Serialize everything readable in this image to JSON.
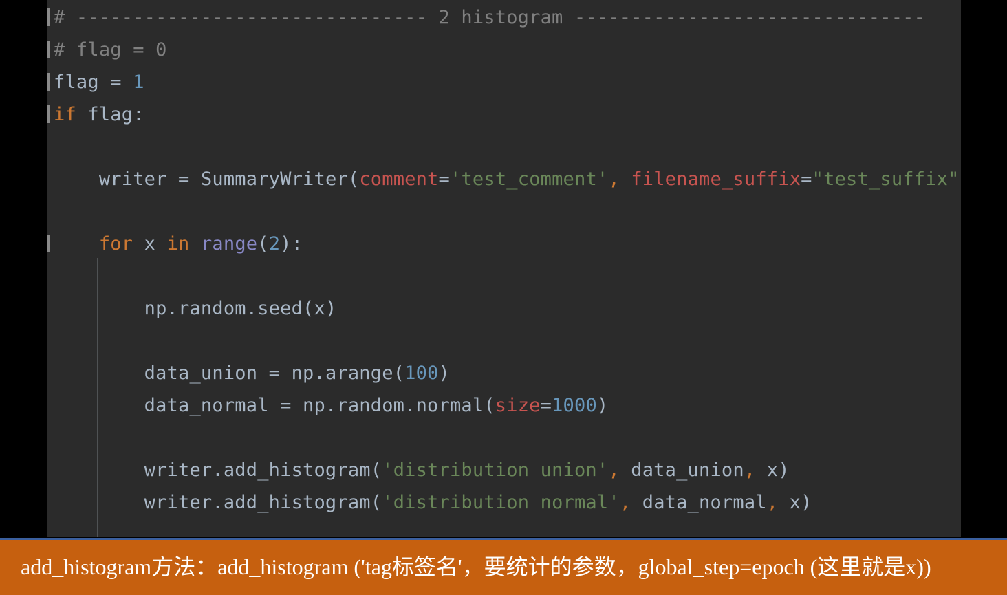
{
  "editor": {
    "background_color": "#2b2b2b",
    "side_band_color": "#000000",
    "lines": [
      {
        "id": "comment-section-header",
        "tokens": [
          {
            "cls": "t-comment",
            "text": "# ------------------------------- 2 histogram -------------------------------"
          }
        ]
      },
      {
        "id": "commented-flag-zero",
        "tokens": [
          {
            "cls": "t-comment",
            "text": "# flag = 0"
          }
        ]
      },
      {
        "id": "flag-assign",
        "tokens": [
          {
            "cls": "t-plain",
            "text": "flag "
          },
          {
            "cls": "t-op",
            "text": "= "
          },
          {
            "cls": "t-num",
            "text": "1"
          }
        ]
      },
      {
        "id": "if-flag",
        "tokens": [
          {
            "cls": "t-keyword",
            "text": "if "
          },
          {
            "cls": "t-plain",
            "text": "flag:"
          }
        ]
      },
      {
        "id": "blank-1",
        "tokens": [
          {
            "cls": "t-plain",
            "text": ""
          }
        ]
      },
      {
        "id": "summarywriter-assign",
        "tokens": [
          {
            "cls": "t-plain",
            "text": "    writer "
          },
          {
            "cls": "t-op",
            "text": "= "
          },
          {
            "cls": "t-plain",
            "text": "SummaryWriter"
          },
          {
            "cls": "t-paren",
            "text": "("
          },
          {
            "cls": "t-kwarg2",
            "text": "comment"
          },
          {
            "cls": "t-op",
            "text": "="
          },
          {
            "cls": "t-str",
            "text": "'test_comment'"
          },
          {
            "cls": "t-comma",
            "text": ", "
          },
          {
            "cls": "t-kwarg2",
            "text": "filename_suffix"
          },
          {
            "cls": "t-op",
            "text": "="
          },
          {
            "cls": "t-str",
            "text": "\"test_suffix\""
          },
          {
            "cls": "t-paren",
            "text": ")"
          }
        ]
      },
      {
        "id": "blank-2",
        "tokens": [
          {
            "cls": "t-plain",
            "text": ""
          }
        ]
      },
      {
        "id": "for-loop",
        "tokens": [
          {
            "cls": "t-plain",
            "text": "    "
          },
          {
            "cls": "t-keyword",
            "text": "for "
          },
          {
            "cls": "t-plain",
            "text": "x "
          },
          {
            "cls": "t-keyword",
            "text": "in "
          },
          {
            "cls": "t-builtin",
            "text": "range"
          },
          {
            "cls": "t-paren",
            "text": "("
          },
          {
            "cls": "t-num",
            "text": "2"
          },
          {
            "cls": "t-paren",
            "text": ")"
          },
          {
            "cls": "t-plain",
            "text": ":"
          }
        ]
      },
      {
        "id": "blank-3",
        "tokens": [
          {
            "cls": "t-plain",
            "text": ""
          }
        ]
      },
      {
        "id": "np-random-seed",
        "tokens": [
          {
            "cls": "t-plain",
            "text": "        np.random.seed"
          },
          {
            "cls": "t-paren",
            "text": "("
          },
          {
            "cls": "t-plain",
            "text": "x"
          },
          {
            "cls": "t-paren",
            "text": ")"
          }
        ]
      },
      {
        "id": "blank-4",
        "tokens": [
          {
            "cls": "t-plain",
            "text": ""
          }
        ]
      },
      {
        "id": "data-union-assign",
        "tokens": [
          {
            "cls": "t-plain",
            "text": "        data_union "
          },
          {
            "cls": "t-op",
            "text": "= "
          },
          {
            "cls": "t-plain",
            "text": "np.arange"
          },
          {
            "cls": "t-paren",
            "text": "("
          },
          {
            "cls": "t-num",
            "text": "100"
          },
          {
            "cls": "t-paren",
            "text": ")"
          }
        ]
      },
      {
        "id": "data-normal-assign",
        "tokens": [
          {
            "cls": "t-plain",
            "text": "        data_normal "
          },
          {
            "cls": "t-op",
            "text": "= "
          },
          {
            "cls": "t-plain",
            "text": "np.random.normal"
          },
          {
            "cls": "t-paren",
            "text": "("
          },
          {
            "cls": "t-kwarg2",
            "text": "size"
          },
          {
            "cls": "t-op",
            "text": "="
          },
          {
            "cls": "t-num",
            "text": "1000"
          },
          {
            "cls": "t-paren",
            "text": ")"
          }
        ]
      },
      {
        "id": "blank-5",
        "tokens": [
          {
            "cls": "t-plain",
            "text": ""
          }
        ]
      },
      {
        "id": "add-histogram-union",
        "tokens": [
          {
            "cls": "t-plain",
            "text": "        writer.add_histogram"
          },
          {
            "cls": "t-paren",
            "text": "("
          },
          {
            "cls": "t-str",
            "text": "'distribution union'"
          },
          {
            "cls": "t-comma",
            "text": ", "
          },
          {
            "cls": "t-plain",
            "text": "data_union"
          },
          {
            "cls": "t-comma",
            "text": ", "
          },
          {
            "cls": "t-plain",
            "text": "x"
          },
          {
            "cls": "t-paren",
            "text": ")"
          }
        ]
      },
      {
        "id": "add-histogram-normal",
        "tokens": [
          {
            "cls": "t-plain",
            "text": "        writer.add_histogram"
          },
          {
            "cls": "t-paren",
            "text": "("
          },
          {
            "cls": "t-str",
            "text": "'distribution normal'"
          },
          {
            "cls": "t-comma",
            "text": ", "
          },
          {
            "cls": "t-plain",
            "text": "data_normal"
          },
          {
            "cls": "t-comma",
            "text": ", "
          },
          {
            "cls": "t-plain",
            "text": "x"
          },
          {
            "cls": "t-paren",
            "text": ")"
          }
        ]
      }
    ]
  },
  "caption": {
    "text": "add_histogram方法：add_histogram ('tag标签名'，要统计的参数，global_step=epoch (这里就是x))",
    "background_color": "#c6600f",
    "text_color": "#ffffff",
    "border_color": "#3b5f9e"
  }
}
